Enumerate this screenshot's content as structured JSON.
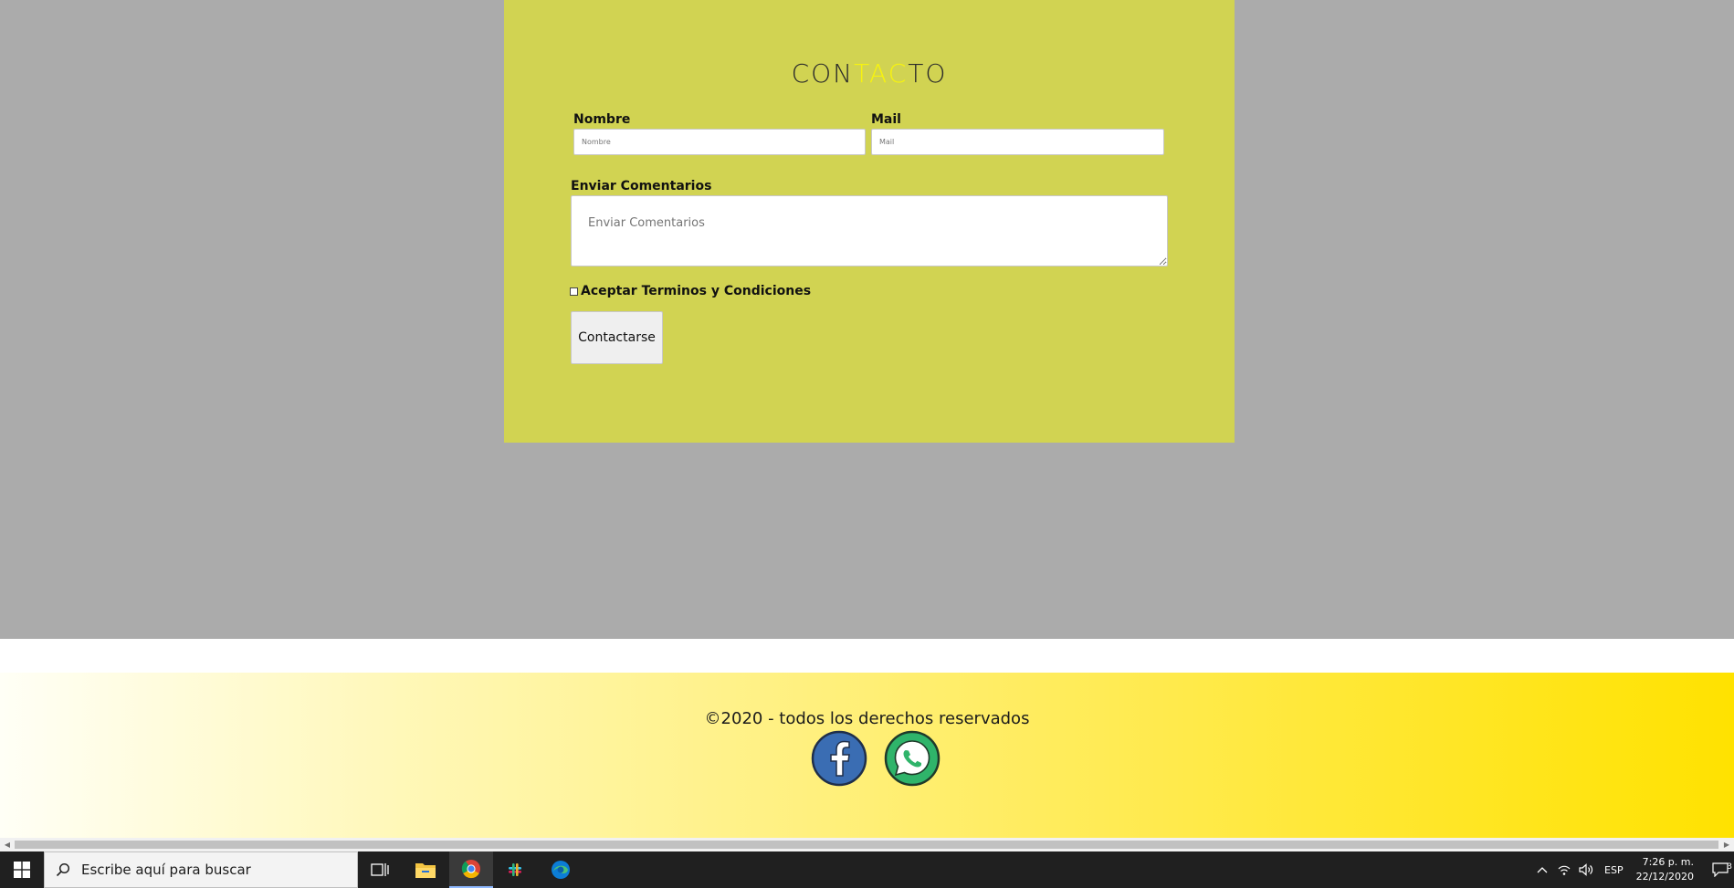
{
  "contact": {
    "title_part1": "CON",
    "title_accent": "TAC",
    "title_part2": "TO",
    "name_label": "Nombre",
    "name_placeholder": "Nombre",
    "mail_label": "Mail",
    "mail_placeholder": "Mail",
    "comments_label": "Enviar Comentarios",
    "comments_placeholder": "Enviar Comentarios",
    "terms_label": "Aceptar Terminos y Condiciones",
    "submit_label": "Contactarse"
  },
  "footer": {
    "copyright": "©2020 - todos los derechos reservados",
    "social": [
      "facebook-icon",
      "whatsapp-icon"
    ]
  },
  "taskbar": {
    "search_placeholder": "Escribe aquí para buscar",
    "language": "ESP",
    "time": "7:26 p. m.",
    "date": "22/12/2020",
    "notification_count": "3"
  },
  "colors": {
    "panel": "#d1d352",
    "title_accent": "#f7f30f",
    "page_bg": "#ababab",
    "footer_end": "#ffe200"
  }
}
